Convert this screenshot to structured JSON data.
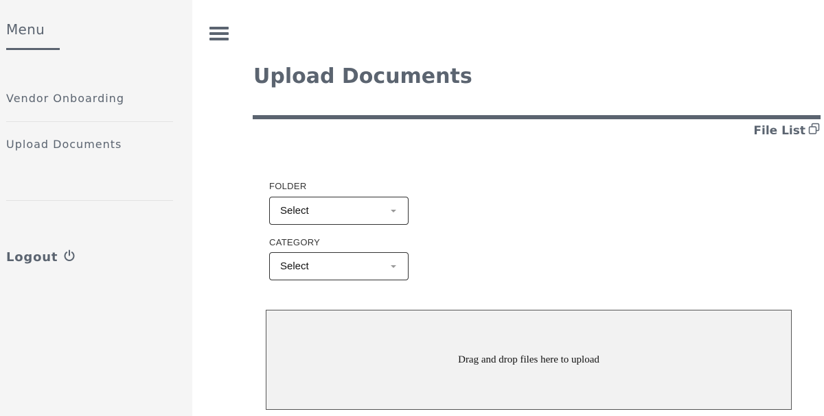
{
  "sidebar": {
    "title": "Menu",
    "items": [
      {
        "label": "Vendor Onboarding"
      },
      {
        "label": "Upload Documents"
      }
    ],
    "logout_label": "Logout",
    "logout_icon": "power-icon"
  },
  "header": {
    "menu_icon": "hamburger-menu-icon"
  },
  "main": {
    "title": "Upload Documents",
    "file_list_label": "File List",
    "file_list_icon": "copy-icon",
    "folder": {
      "label": "FOLDER",
      "value": "Select"
    },
    "category": {
      "label": "CATEGORY",
      "value": "Select"
    },
    "dropzone_text": "Drag and drop files here to upload"
  },
  "colors": {
    "accent": "#5b6470",
    "sidebar_bg": "#f5f5f5",
    "dropzone_bg": "#f2f2f2"
  }
}
